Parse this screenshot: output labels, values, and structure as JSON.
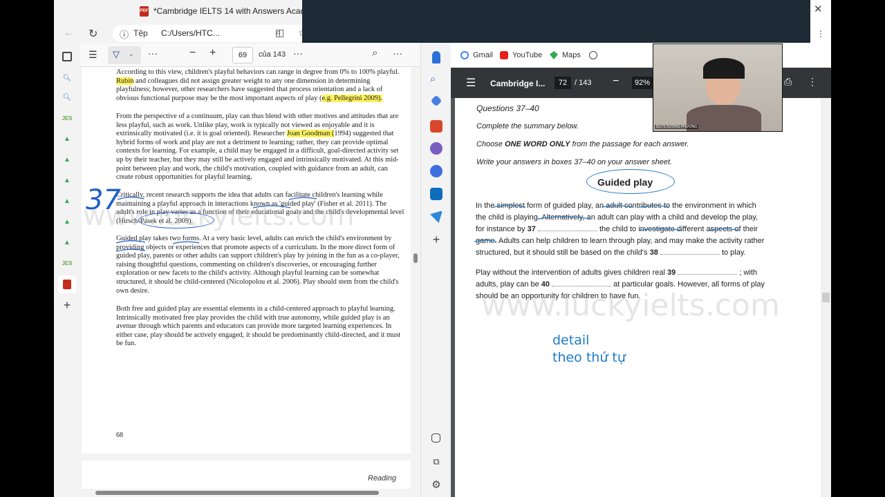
{
  "left_window": {
    "tab_title": "*Cambridge IELTS 14 with Answers Academic [ww",
    "addr_label": "Tệp",
    "addr_url": "C:/Users/HTC...",
    "page_number": "69",
    "page_of": "của 143",
    "page_footer": "68",
    "page2_footer": "Reading",
    "para1": "According to this view, children's playful behaviors can range in degree from 0% to 100% playful.",
    "para1_hl1": "Rubin",
    "para1b": "and colleagues did not assign greater weight to any one dimension in determining playfulness; however, other researchers have suggested that process orientation and a lack of obvious functional purpose may be the most important aspects of play (",
    "para1_hl2": "e.g. Pellegrini 2009).",
    "para2a": "From the perspective of a continuum, play can thus blend with other motives and attitudes that are less playful, such as work. Unlike play, work is typically not viewed as enjoyable and it is extrinsically motivated (i.e. it is goal oriented). Researcher",
    "para2_hl": "Joan Goodman (",
    "para2b": "1994) suggested that hybrid forms of work and play are not a detriment to learning; rather, they can provide optimal contexts for learning. For example, a child may be engaged in a difficult, goal-directed activity set up by their teacher, but they may still be actively engaged and intrinsically motivated. At this mid-point between play and work, the child's motivation, coupled with guidance from an adult, can create robust opportunities for playful learning.",
    "para3": "Critically, recent research supports the idea that adults can facilitate children's learning while maintaining a playful approach in interactions known as 'guided play' (Fisher et al. 2011). The adult's role in play varies as a function of their educational goals and the child's developmental level (Hirsch-Pasek et al. 2009).",
    "para4": "Guided play takes two forms. At a very basic level, adults can enrich the child's environment by providing objects or experiences that promote aspects of a curriculum. In the more direct form of guided play, parents or other adults can support children's play by joining in the fun as a co-player, raising thoughtful questions, commenting on children's discoveries, or encouraging further exploration or new facets to the child's activity. Although playful learning can be somewhat structured, it should be child-centered (Nicolopolou et al. 2006). Play should stem from the child's own desire.",
    "para5": "Both free and guided play are essential elements in a child-centered approach to playful learning. Intrinsically motivated free play provides the child with true autonomy, while guided play is an avenue through which parents and educators can provide more targeted learning experiences. In either case, play should be actively engaged, it should be predominantly child-directed, and it must be fun.",
    "annotation_37": "37"
  },
  "right_window": {
    "bookmarks": [
      {
        "label": "Gmail"
      },
      {
        "label": "YouTube"
      },
      {
        "label": "Maps"
      }
    ],
    "doc_title": "Cambridge I...",
    "page_current": "72",
    "page_total": "/ 143",
    "zoom": "92%",
    "questions_heading": "Questions 37–40",
    "instruction1": "Complete the summary below.",
    "instruction2a": "Choose ",
    "instruction2b": "ONE WORD ONLY",
    "instruction2c": " from the passage for each answer.",
    "instruction3": "Write your answers in boxes 37–40 on your answer sheet.",
    "summary_title": "Guided play",
    "sum_l1": "In the simplest form of guided play, an adult contributes to the environment in which",
    "sum_l2": "the child is playing. Alternatively, an adult can play with a child and develop the play,",
    "sum_l3a": "for instance by ",
    "q37": "37",
    "sum_l3b": " the child to investigate different aspects of their",
    "sum_l4": "game. Adults can help children to learn through play, and may make the activity rather",
    "sum_l5a": "structured, but it should still be based on the child's ",
    "q38": "38",
    "sum_l5b": " to play.",
    "sum2_l1a": "Play without the intervention of adults gives children real ",
    "q39": "39",
    "sum2_l1b": " ; with",
    "sum2_l2a": "adults, play can be ",
    "q40": "40",
    "sum2_l2b": " at particular goals. However, all forms of play",
    "sum2_l3": "should be an opportunity for children to have fun.",
    "note1": "detail",
    "note2": "theo thứ tự",
    "watermark": "www.luckyielts.com",
    "webcam_label": "IELTS DƯƠNG PHƯƠNG"
  },
  "colors": {
    "highlight": "#fff35c",
    "ink": "#1f7ac9",
    "pdf_header": "#323639"
  }
}
